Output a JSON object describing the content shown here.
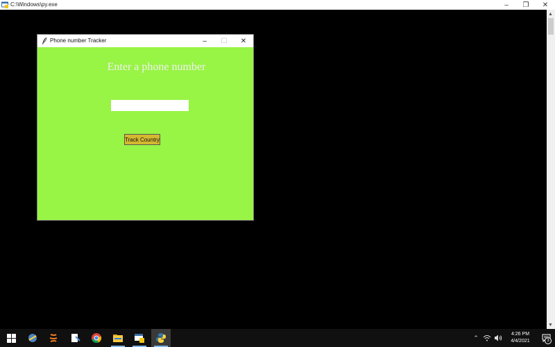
{
  "console": {
    "title": "C:\\Windows\\py.exe",
    "icon": "python-launcher-icon"
  },
  "tk_window": {
    "title": "Phone number Tracker",
    "heading": "Enter a phone number",
    "entry_value": "",
    "button_label": "Track Country",
    "background_color": "#98f445",
    "button_color": "#d4b830",
    "heading_color": "#f0f0f0"
  },
  "taskbar": {
    "apps": [
      "idle-icon",
      "eclipse-icon",
      "notepad-icon",
      "chrome-icon",
      "file-explorer-icon",
      "python-launcher-icon",
      "python-icon"
    ],
    "active_app": "python-icon",
    "clock_time": "4:26 PM",
    "clock_date": "4/4/2021",
    "notification_count": "3"
  }
}
